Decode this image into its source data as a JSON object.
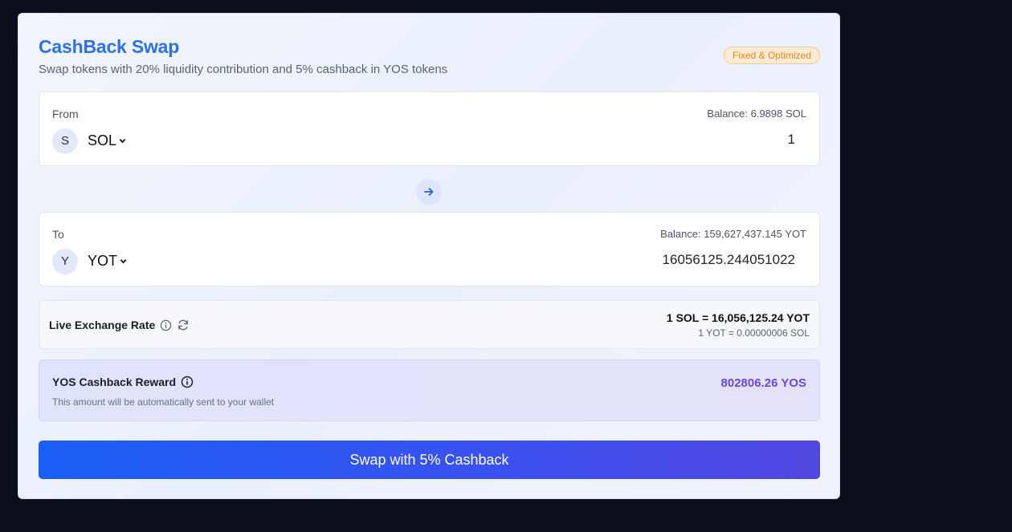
{
  "header": {
    "title": "CashBack Swap",
    "subtitle": "Swap tokens with 20% liquidity contribution and 5% cashback in YOS tokens",
    "badge": "Fixed & Optimized"
  },
  "from": {
    "label": "From",
    "balance": "Balance: 6.9898 SOL",
    "token_initial": "S",
    "token": "SOL",
    "amount": "1"
  },
  "to": {
    "label": "To",
    "balance": "Balance: 159,627,437.145 YOT",
    "token_initial": "Y",
    "token": "YOT",
    "amount": "16056125.244051022"
  },
  "rate": {
    "label": "Live Exchange Rate",
    "primary": "1 SOL = 16,056,125.24 YOT",
    "secondary": "1 YOT = 0.00000006 SOL"
  },
  "cashback": {
    "label": "YOS Cashback Reward",
    "note": "This amount will be automatically sent to your wallet",
    "value": "802806.26 YOS"
  },
  "action": {
    "label": "Swap with 5% Cashback"
  },
  "colors": {
    "accent": "#2f6fe8",
    "badge_text": "#e2891b",
    "cashback_value": "#6b47d6",
    "button_start": "#1a5ff5",
    "button_end": "#5247e0"
  },
  "icons": {
    "direction": "arrow-right-icon",
    "info": "info-icon",
    "refresh": "refresh-icon",
    "dropdown": "chevron-down-icon"
  }
}
